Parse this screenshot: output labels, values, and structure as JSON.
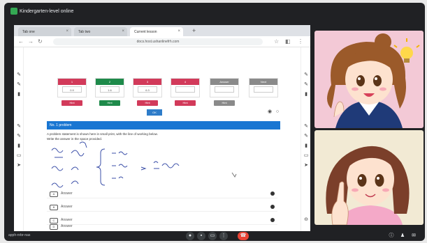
{
  "meet": {
    "title": "Kindergarten-level online",
    "meeting_code": "apph-nrbr-nas"
  },
  "browser": {
    "tabs": [
      {
        "label": "Tab one"
      },
      {
        "label": "Tab two"
      },
      {
        "label": "Current lesson"
      }
    ],
    "address": "docs.host.ushanlinefrh.com"
  },
  "content": {
    "cards": [
      {
        "head": "1",
        "body": "0.9",
        "btn": "Hint"
      },
      {
        "head": "2",
        "body": "1.6",
        "btn": "Hint"
      },
      {
        "head": "3",
        "body": "6.3",
        "btn": "Hint"
      },
      {
        "head": "4",
        "body": "",
        "btn": "Hint"
      },
      {
        "head": "Answer",
        "body": "",
        "btn": "Hint"
      },
      {
        "head": "Next",
        "body": "",
        "btn": ""
      }
    ],
    "confirm_label": "OK",
    "section_title": "No. 1 problem",
    "question_line1": "A problem statement is shown here in small print, with the line of working below.",
    "question_line2": "Write the answer in the space provided.",
    "rows": [
      {
        "icon": "A",
        "text": "Answer"
      },
      {
        "icon": "B",
        "text": "Answer"
      },
      {
        "icon": "C",
        "text": "Answer"
      },
      {
        "icon": "D",
        "text": "Answer"
      },
      {
        "icon": "E",
        "text": "Answer"
      }
    ]
  },
  "colors": {
    "crimson": "#d23a5a",
    "green": "#1e8a4a",
    "gray": "#8a8a8a",
    "blue_bar": "#1976d2"
  },
  "icons": [
    "mic-icon",
    "camera-icon",
    "present-icon",
    "more-icon",
    "hangup-icon",
    "info-icon",
    "people-icon",
    "chat-icon"
  ]
}
